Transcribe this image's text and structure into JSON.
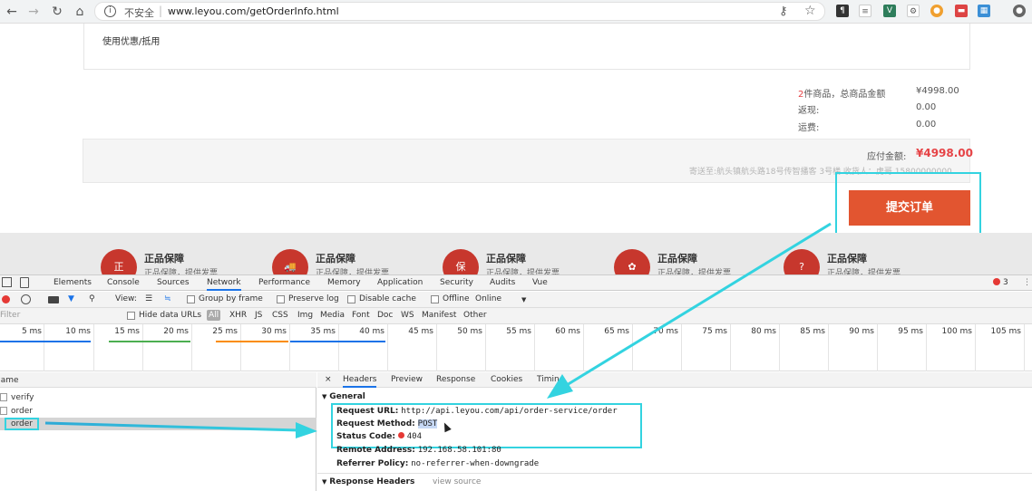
{
  "browser": {
    "back_icon": "←",
    "forward_icon": "→",
    "reload_icon": "↻",
    "home_icon": "⌂",
    "info_icon": "i",
    "security_text": "不安全",
    "url": "www.leyou.com/getOrderInfo.html",
    "key_icon": "⚷",
    "star_icon": "☆"
  },
  "coupon": {
    "label": "使用优惠/抵用"
  },
  "summary": {
    "items_count": "2",
    "items_label": "件商品，总商品金额",
    "items_total": "¥4998.00",
    "cashback_label": "返现:",
    "cashback_value": "0.00",
    "shipping_label": "运费:",
    "shipping_value": "0.00"
  },
  "payment": {
    "label": "应付金额:",
    "amount": "¥4998.00",
    "address": "寄送至:航头镇航头路18号传智播客 3号楼 收货人：虎哥 15800000000"
  },
  "submit_button": {
    "label": "提交订单"
  },
  "promos": [
    {
      "icon": "正",
      "title": "正品保障",
      "sub": "正品保障，提供发票"
    },
    {
      "icon": "🚚",
      "title": "正品保障",
      "sub": "正品保障，提供发票"
    },
    {
      "icon": "保",
      "title": "正品保障",
      "sub": "正品保障，提供发票"
    },
    {
      "icon": "✿",
      "title": "正品保障",
      "sub": "正品保障，提供发票"
    },
    {
      "icon": "?",
      "title": "正品保障",
      "sub": "正品保障，提供发票"
    }
  ],
  "devtools": {
    "tabs": [
      "Elements",
      "Console",
      "Sources",
      "Network",
      "Performance",
      "Memory",
      "Application",
      "Security",
      "Audits",
      "Vue"
    ],
    "error_count": "3",
    "toolbar": {
      "view_label": "View:",
      "group_by_frame": "Group by frame",
      "preserve_log": "Preserve log",
      "disable_cache": "Disable cache",
      "offline": "Offline",
      "throttle": "Online"
    },
    "filter": {
      "placeholder": "Filter",
      "hide_data_urls": "Hide data URLs",
      "types": [
        "All",
        "XHR",
        "JS",
        "CSS",
        "Img",
        "Media",
        "Font",
        "Doc",
        "WS",
        "Manifest",
        "Other"
      ]
    },
    "timeline_ticks": [
      "5 ms",
      "10 ms",
      "15 ms",
      "20 ms",
      "25 ms",
      "30 ms",
      "35 ms",
      "40 ms",
      "45 ms",
      "50 ms",
      "55 ms",
      "60 ms",
      "65 ms",
      "70 ms",
      "75 ms",
      "80 ms",
      "85 ms",
      "90 ms",
      "95 ms",
      "100 ms",
      "105 ms"
    ],
    "name_header": "Name",
    "requests": [
      "verify",
      "order",
      "order"
    ],
    "detail_tabs": [
      "Headers",
      "Preview",
      "Response",
      "Cookies",
      "Timing"
    ],
    "general": {
      "section": "General",
      "request_url_label": "Request URL:",
      "request_url": "http://api.leyou.com/api/order-service/order",
      "request_method_label": "Request Method:",
      "request_method": "POST",
      "status_code_label": "Status Code:",
      "status_code": "404",
      "remote_address_label": "Remote Address:",
      "remote_address": "192.168.58.101:80",
      "referrer_policy_label": "Referrer Policy:",
      "referrer_policy": "no-referrer-when-downgrade"
    },
    "response_headers": {
      "section": "Response Headers",
      "view_source": "view source"
    }
  },
  "colors": {
    "accent_red": "#e64346",
    "submit_bg": "#e25530",
    "annotation_cyan": "#33d3e0",
    "devtools_blue": "#1a73e8"
  }
}
